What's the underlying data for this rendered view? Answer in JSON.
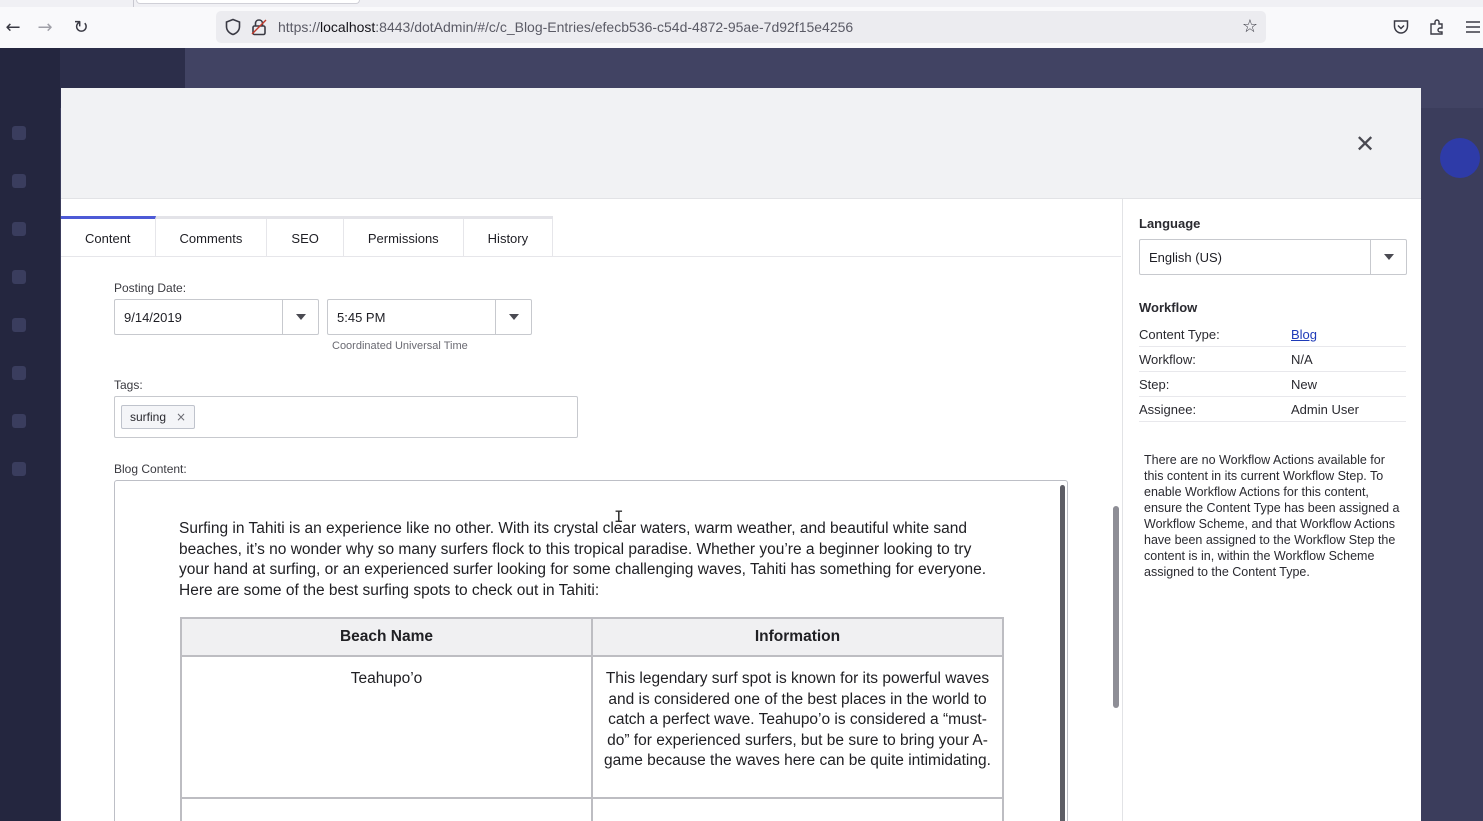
{
  "browser": {
    "url_prefix": "https://",
    "url_host": "localhost",
    "url_rest": ":8443/dotAdmin/#/c/c_Blog-Entries/efecb536-c54d-4872-95ae-7d92f15e4256"
  },
  "icons": {
    "back": "←",
    "forward": "→",
    "reload": "↻",
    "star": "☆",
    "close": "✕",
    "tag_remove": "×"
  },
  "colors": {
    "accent": "#4d5ad6",
    "link": "#1f3bb8"
  },
  "tabs": [
    {
      "label": "Content"
    },
    {
      "label": "Comments"
    },
    {
      "label": "SEO"
    },
    {
      "label": "Permissions"
    },
    {
      "label": "History"
    }
  ],
  "form": {
    "posting_date_label": "Posting Date:",
    "date_value": "9/14/2019",
    "time_value": "5:45 PM",
    "timezone_hint": "Coordinated Universal Time",
    "tags_label": "Tags:",
    "tags": [
      "surfing"
    ],
    "blog_content_label": "Blog Content:"
  },
  "blog": {
    "intro": "Surfing in Tahiti is an experience like no other. With its crystal clear waters, warm weather, and beautiful white sand beaches, it’s no wonder why so many surfers flock to this tropical paradise. Whether you’re a beginner looking to try your hand at surfing, or an experienced surfer looking for some challenging waves, Tahiti has something for everyone. Here are some of the best surfing spots to check out in Tahiti:",
    "table_headers": [
      "Beach Name",
      "Information"
    ],
    "rows": [
      {
        "beach": "Teahupo’o",
        "info": "This legendary surf spot is known for its powerful waves and is considered one of the best places in the world to catch a perfect wave. Teahupo’o is considered a “must-do” for experienced surfers, but be sure to bring your A-game because the waves here can be quite intimidating."
      }
    ]
  },
  "sidebar": {
    "language_label": "Language",
    "language_value": "English (US)",
    "workflow_heading": "Workflow",
    "workflow_rows": [
      {
        "key": "Content Type:",
        "value": "Blog"
      },
      {
        "key": "Workflow:",
        "value": "N/A"
      },
      {
        "key": "Step:",
        "value": "New"
      },
      {
        "key": "Assignee:",
        "value": "Admin User"
      }
    ],
    "notice": "There are no Workflow Actions available for this content in its current Workflow Step. To enable Workflow Actions for this content, ensure the Content Type has been assigned a Workflow Scheme, and that Workflow Actions have been assigned to the Workflow Step the content is in, within the Workflow Scheme assigned to the Content Type."
  }
}
